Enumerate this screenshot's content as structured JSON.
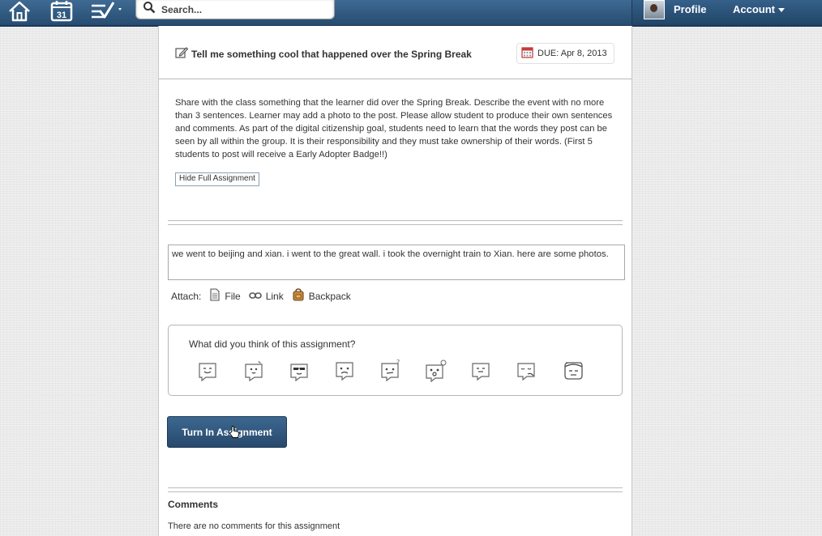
{
  "nav": {
    "calendar_day": "31",
    "search_placeholder": "Search...",
    "profile_label": "Profile",
    "account_label": "Account",
    "bar_color": "#2f5a82"
  },
  "assignment": {
    "title": "Tell me something cool that happened over the Spring Break",
    "due_label": "DUE: Apr 8, 2013",
    "description": "Share with the class something that the learner did over the Spring Break. Describe the event with no more than 3 sentences. Learner may add a photo to the post. Please allow student to produce their own sentences and comments. As part of the digital citizenship goal, students need to learn that the words they post can be seen by all within the group. It is their responsibility and they must take ownership of their words. (First 5 students to post will receive a Early Adopter Badge!!)",
    "hide_button": "Hide Full Assignment"
  },
  "response": {
    "text": "we went to beijing and xian. i went to the great wall. i took the overnight train to Xian. here are some photos."
  },
  "attach": {
    "label": "Attach:",
    "items": [
      {
        "label": "File",
        "icon": "file-icon"
      },
      {
        "label": "Link",
        "icon": "link-icon"
      },
      {
        "label": "Backpack",
        "icon": "backpack-icon"
      }
    ]
  },
  "feedback": {
    "question": "What did you think of this assignment?",
    "reactions": [
      "happy-face-icon",
      "excited-face-icon",
      "cool-face-icon",
      "sad-face-icon",
      "confused-face-icon",
      "surprised-face-icon",
      "content-face-icon",
      "tired-face-icon",
      "bored-face-icon"
    ]
  },
  "turn_in_label": "Turn In Assignment",
  "comments": {
    "heading": "Comments",
    "empty_text": "There are no comments for this assignment"
  }
}
